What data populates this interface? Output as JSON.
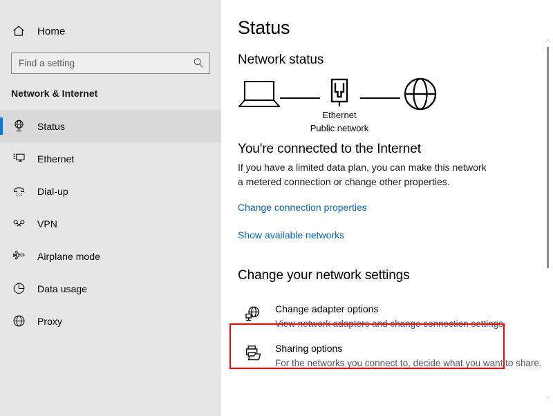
{
  "sidebar": {
    "home": {
      "label": "Home",
      "icon": "home-icon"
    },
    "search": {
      "placeholder": "Find a setting",
      "value": "",
      "icon": "search-icon"
    },
    "category_title": "Network & Internet",
    "items": [
      {
        "label": "Status",
        "icon": "network-status-icon",
        "selected": true
      },
      {
        "label": "Ethernet",
        "icon": "ethernet-icon",
        "selected": false
      },
      {
        "label": "Dial-up",
        "icon": "dial-up-icon",
        "selected": false
      },
      {
        "label": "VPN",
        "icon": "vpn-icon",
        "selected": false
      },
      {
        "label": "Airplane mode",
        "icon": "airplane-icon",
        "selected": false
      },
      {
        "label": "Data usage",
        "icon": "data-usage-icon",
        "selected": false
      },
      {
        "label": "Proxy",
        "icon": "proxy-icon",
        "selected": false
      }
    ]
  },
  "main": {
    "page_title": "Status",
    "network_status_heading": "Network status",
    "diagram": {
      "device_caption_line1": "",
      "connection_caption_line1": "Ethernet",
      "connection_caption_line2": "Public network"
    },
    "connection": {
      "heading": "You're connected to the Internet",
      "description": "If you have a limited data plan, you can make this network a metered connection or change other properties.",
      "change_properties_link": "Change connection properties",
      "show_networks_link": "Show available networks"
    },
    "settings_section": {
      "heading": "Change your network settings",
      "options": [
        {
          "title": "Change adapter options",
          "description": "View network adapters and change connection settings.",
          "icon": "adapter-options-icon",
          "highlighted": true
        },
        {
          "title": "Sharing options",
          "description": "For the networks you connect to, decide what you want to share.",
          "icon": "sharing-options-icon",
          "highlighted": false
        }
      ]
    }
  },
  "colors": {
    "accent": "#0078d7",
    "link": "#0067c0",
    "highlight_box": "#fe0000",
    "sidebar_bg": "#e6e6e6",
    "content_bg": "#ffffff"
  }
}
